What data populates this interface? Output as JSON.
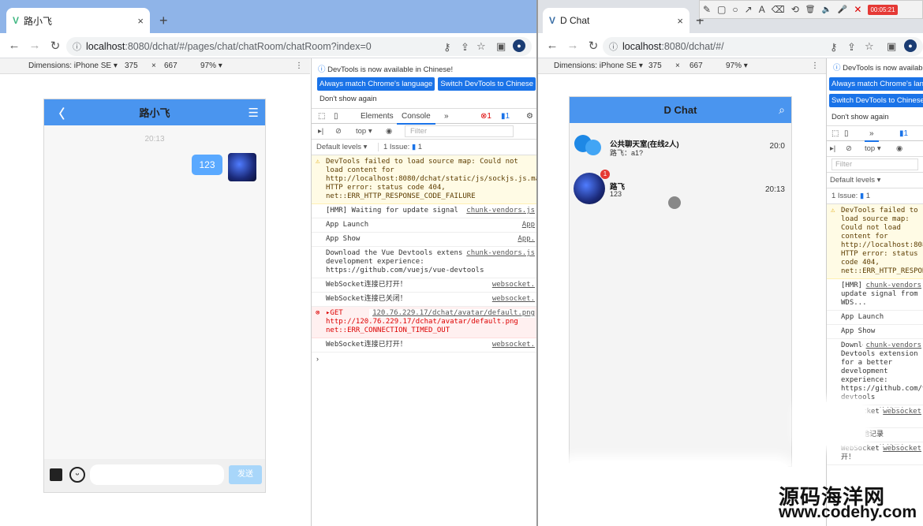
{
  "left": {
    "tab_title": "路小飞",
    "tab_close": "×",
    "new_tab": "+",
    "url_host": "localhost",
    "url_path": ":8080/dchat/#/pages/chat/chatRoom/chatRoom?index=0",
    "dims_label": "Dimensions: iPhone SE ▾",
    "width": "375",
    "times": "×",
    "height": "667",
    "zoom": "97% ▾",
    "phone": {
      "title": "路小飞",
      "back": "〈",
      "menu": "☰",
      "time": "20:13",
      "message": "123",
      "send_label": "发送"
    },
    "devtools": {
      "notice": "DevTools is now available in Chinese!",
      "btn_match": "Always match Chrome's language",
      "btn_switch": "Switch DevTools to Chinese",
      "dont_show": "Don't show again",
      "tab_elements": "Elements",
      "tab_console": "Console",
      "tab_more": "»",
      "err_count": "1",
      "msg_count": "1",
      "context": "top ▾",
      "filter": "Filter",
      "levels": "Default levels ▾",
      "issues": "1 Issue:",
      "issues_count": "1",
      "logs": [
        {
          "kind": "warn",
          "text": "DevTools failed to load source map: Could not load content for http://localhost:8080/dchat/static/js/sockjs.js.map: HTTP error: status code 404, net::ERR_HTTP_RESPONSE_CODE_FAILURE",
          "src": ""
        },
        {
          "kind": "info",
          "text": "[HMR] Waiting for update signal from WDS...",
          "src": "chunk-vendors.js"
        },
        {
          "kind": "info",
          "text": "App Launch",
          "src": "App"
        },
        {
          "kind": "info",
          "text": "App Show",
          "src": "App."
        },
        {
          "kind": "info",
          "text": "Download the Vue Devtools extension for a better development experience: https://github.com/vuejs/vue-devtools",
          "src": "chunk-vendors.js"
        },
        {
          "kind": "info",
          "text": "WebSocket连接已打开！",
          "src": "websocket."
        },
        {
          "kind": "info",
          "text": "WebSocket连接已关闭！",
          "src": "websocket."
        },
        {
          "kind": "err",
          "text": "▸GET http://120.76.229.17/dchat/avatar/default.png net::ERR_CONNECTION_TIMED_OUT",
          "src": "120.76.229.17/dchat/avatar/default.png"
        },
        {
          "kind": "info",
          "text": "WebSocket连接已打开！",
          "src": "websocket."
        }
      ],
      "prompt": "›"
    }
  },
  "right": {
    "tab_title": "D Chat",
    "tab_close": "×",
    "new_tab": "+",
    "url_host": "localhost",
    "url_path": ":8080/dchat/#/",
    "dims_label": "Dimensions: iPhone SE ▾",
    "width": "375",
    "times": "×",
    "height": "667",
    "zoom": "97% ▾",
    "phone": {
      "title": "D Chat",
      "chats": [
        {
          "name": "公共聊天室(在线2人)",
          "preview": "路飞：a1?",
          "time": "20:0",
          "badge": ""
        },
        {
          "name": "路飞",
          "preview": "123",
          "time": "20:13",
          "badge": "1"
        }
      ]
    },
    "devtools": {
      "notice": "DevTools is now available",
      "btn_match": "Always match Chrome's lang",
      "btn_switch": "Switch DevTools to Chinese",
      "dont_show": "Don't show again",
      "tab_more": "»",
      "msg_count": "1",
      "context": "top ▾",
      "filter": "Filter",
      "levels": "Default levels ▾",
      "issues": "1 Issue:",
      "issues_count": "1",
      "logs": [
        {
          "kind": "warn",
          "text": "DevTools failed to load source map: Could not load content for http://localhost:8080/dchat/static/js/sockjs.js.map: HTTP error: status code 404, net::ERR_HTTP_RESPONSE_CODE_FAILURE"
        },
        {
          "kind": "info",
          "text": "[HMR] Waiting for update signal from WDS...",
          "src": "chunk-vendors"
        },
        {
          "kind": "info",
          "text": "App Launch"
        },
        {
          "kind": "info",
          "text": "App Show"
        },
        {
          "kind": "info",
          "text": "Download the Vue Devtools extension for a better development experience: https://github.com/vuejs/vue-devtools",
          "src": "chunk-vendors"
        },
        {
          "kind": "info",
          "text": "WebSocket连接已打开！",
          "src": "websocket"
        },
        {
          "kind": "info",
          "text": "清除本地记录"
        },
        {
          "kind": "info",
          "text": "WebSocket连接已打开！",
          "src": "websocket"
        }
      ]
    }
  },
  "annotation_toolbar": {
    "tools": [
      "✎",
      "▢",
      "○",
      "↗",
      "A",
      "⌫",
      "⟲",
      "🗑",
      "🔈",
      "🎤",
      "✕"
    ],
    "timer": "00:05:21"
  },
  "watermark": {
    "line1": "源码海洋网",
    "line2": "www.codehy.com"
  },
  "colors": {
    "accent": "#4a95ef",
    "bubble": "#5aa9ff",
    "devtools_button": "#1a73e8",
    "warn_bg": "#fffbe5",
    "error_bg": "#fff0f0",
    "badge": "#e53935"
  }
}
